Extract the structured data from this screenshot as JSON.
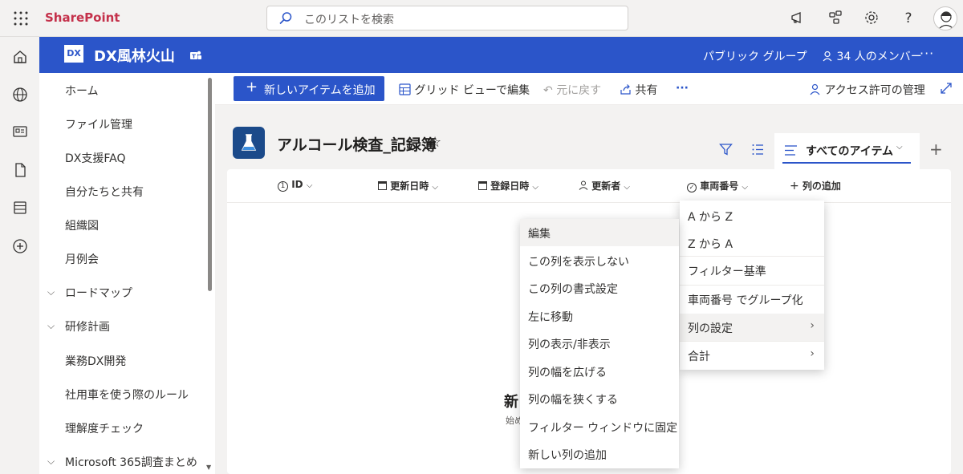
{
  "suite": {
    "brand": "SharePoint",
    "search_placeholder": "このリストを検索",
    "icons": [
      "waffle-icon",
      "megaphone-icon",
      "share-network-icon",
      "settings-icon",
      "help-icon",
      "avatar"
    ]
  },
  "site": {
    "logo_text": "DX",
    "name": "DX風林火山",
    "group_type": "パブリック グループ",
    "members": "34 人のメンバー",
    "more": "···"
  },
  "leftnav": {
    "items": [
      {
        "label": "ホーム",
        "expandable": false
      },
      {
        "label": "ファイル管理",
        "expandable": false
      },
      {
        "label": "DX支援FAQ",
        "expandable": false
      },
      {
        "label": "自分たちと共有",
        "expandable": false
      },
      {
        "label": "組織図",
        "expandable": false
      },
      {
        "label": "月例会",
        "expandable": false
      },
      {
        "label": "ロードマップ",
        "expandable": true
      },
      {
        "label": "研修計画",
        "expandable": true
      },
      {
        "label": "業務DX開発",
        "expandable": false
      },
      {
        "label": "社用車を使う際のルール",
        "expandable": false
      },
      {
        "label": "理解度チェック",
        "expandable": false
      },
      {
        "label": "Microsoft 365調査まとめ",
        "expandable": true
      }
    ]
  },
  "commandbar": {
    "new_item": "新しいアイテムを追加",
    "grid_edit": "グリッド ビューで編集",
    "undo": "元に戻す",
    "share": "共有",
    "more": "···",
    "access": "アクセス許可の管理"
  },
  "list": {
    "title": "アルコール検査_記録簿",
    "view_name": "すべてのアイテム",
    "columns": [
      "ID",
      "更新日時",
      "登録日時",
      "更新者",
      "車両番号",
      "列の追加"
    ],
    "empty_title": "新",
    "empty_sub": "始め"
  },
  "column_menu": {
    "items": [
      "A から Z",
      "Z から A",
      "フィルター基準",
      "車両番号 でグループ化",
      "列の設定",
      "合計"
    ]
  },
  "settings_submenu": {
    "items": [
      "編集",
      "この列を表示しない",
      "この列の書式設定",
      "左に移動",
      "列の表示/非表示",
      "列の幅を広げる",
      "列の幅を狭くする",
      "フィルター ウィンドウに固定",
      "新しい列の追加"
    ]
  },
  "colors": {
    "brand_red": "#c4314b",
    "header_blue": "#2b55c9",
    "list_icon": "#1b4a8a"
  }
}
